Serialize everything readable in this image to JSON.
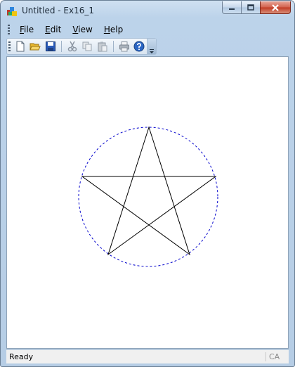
{
  "window": {
    "title": "Untitled - Ex16_1"
  },
  "menubar": {
    "items": [
      {
        "label": "File",
        "mnemonic": "F",
        "rest": "ile"
      },
      {
        "label": "Edit",
        "mnemonic": "E",
        "rest": "dit"
      },
      {
        "label": "View",
        "mnemonic": "V",
        "rest": "iew"
      },
      {
        "label": "Help",
        "mnemonic": "H",
        "rest": "elp"
      }
    ]
  },
  "toolbar": {
    "buttons": [
      "new-icon",
      "open-icon",
      "save-icon",
      "cut-icon",
      "copy-icon",
      "paste-icon",
      "print-icon",
      "help-icon"
    ]
  },
  "canvas": {
    "circle_color": "#0000cc",
    "star_color": "#000000"
  },
  "statusbar": {
    "message": "Ready",
    "indicator": "CA"
  }
}
